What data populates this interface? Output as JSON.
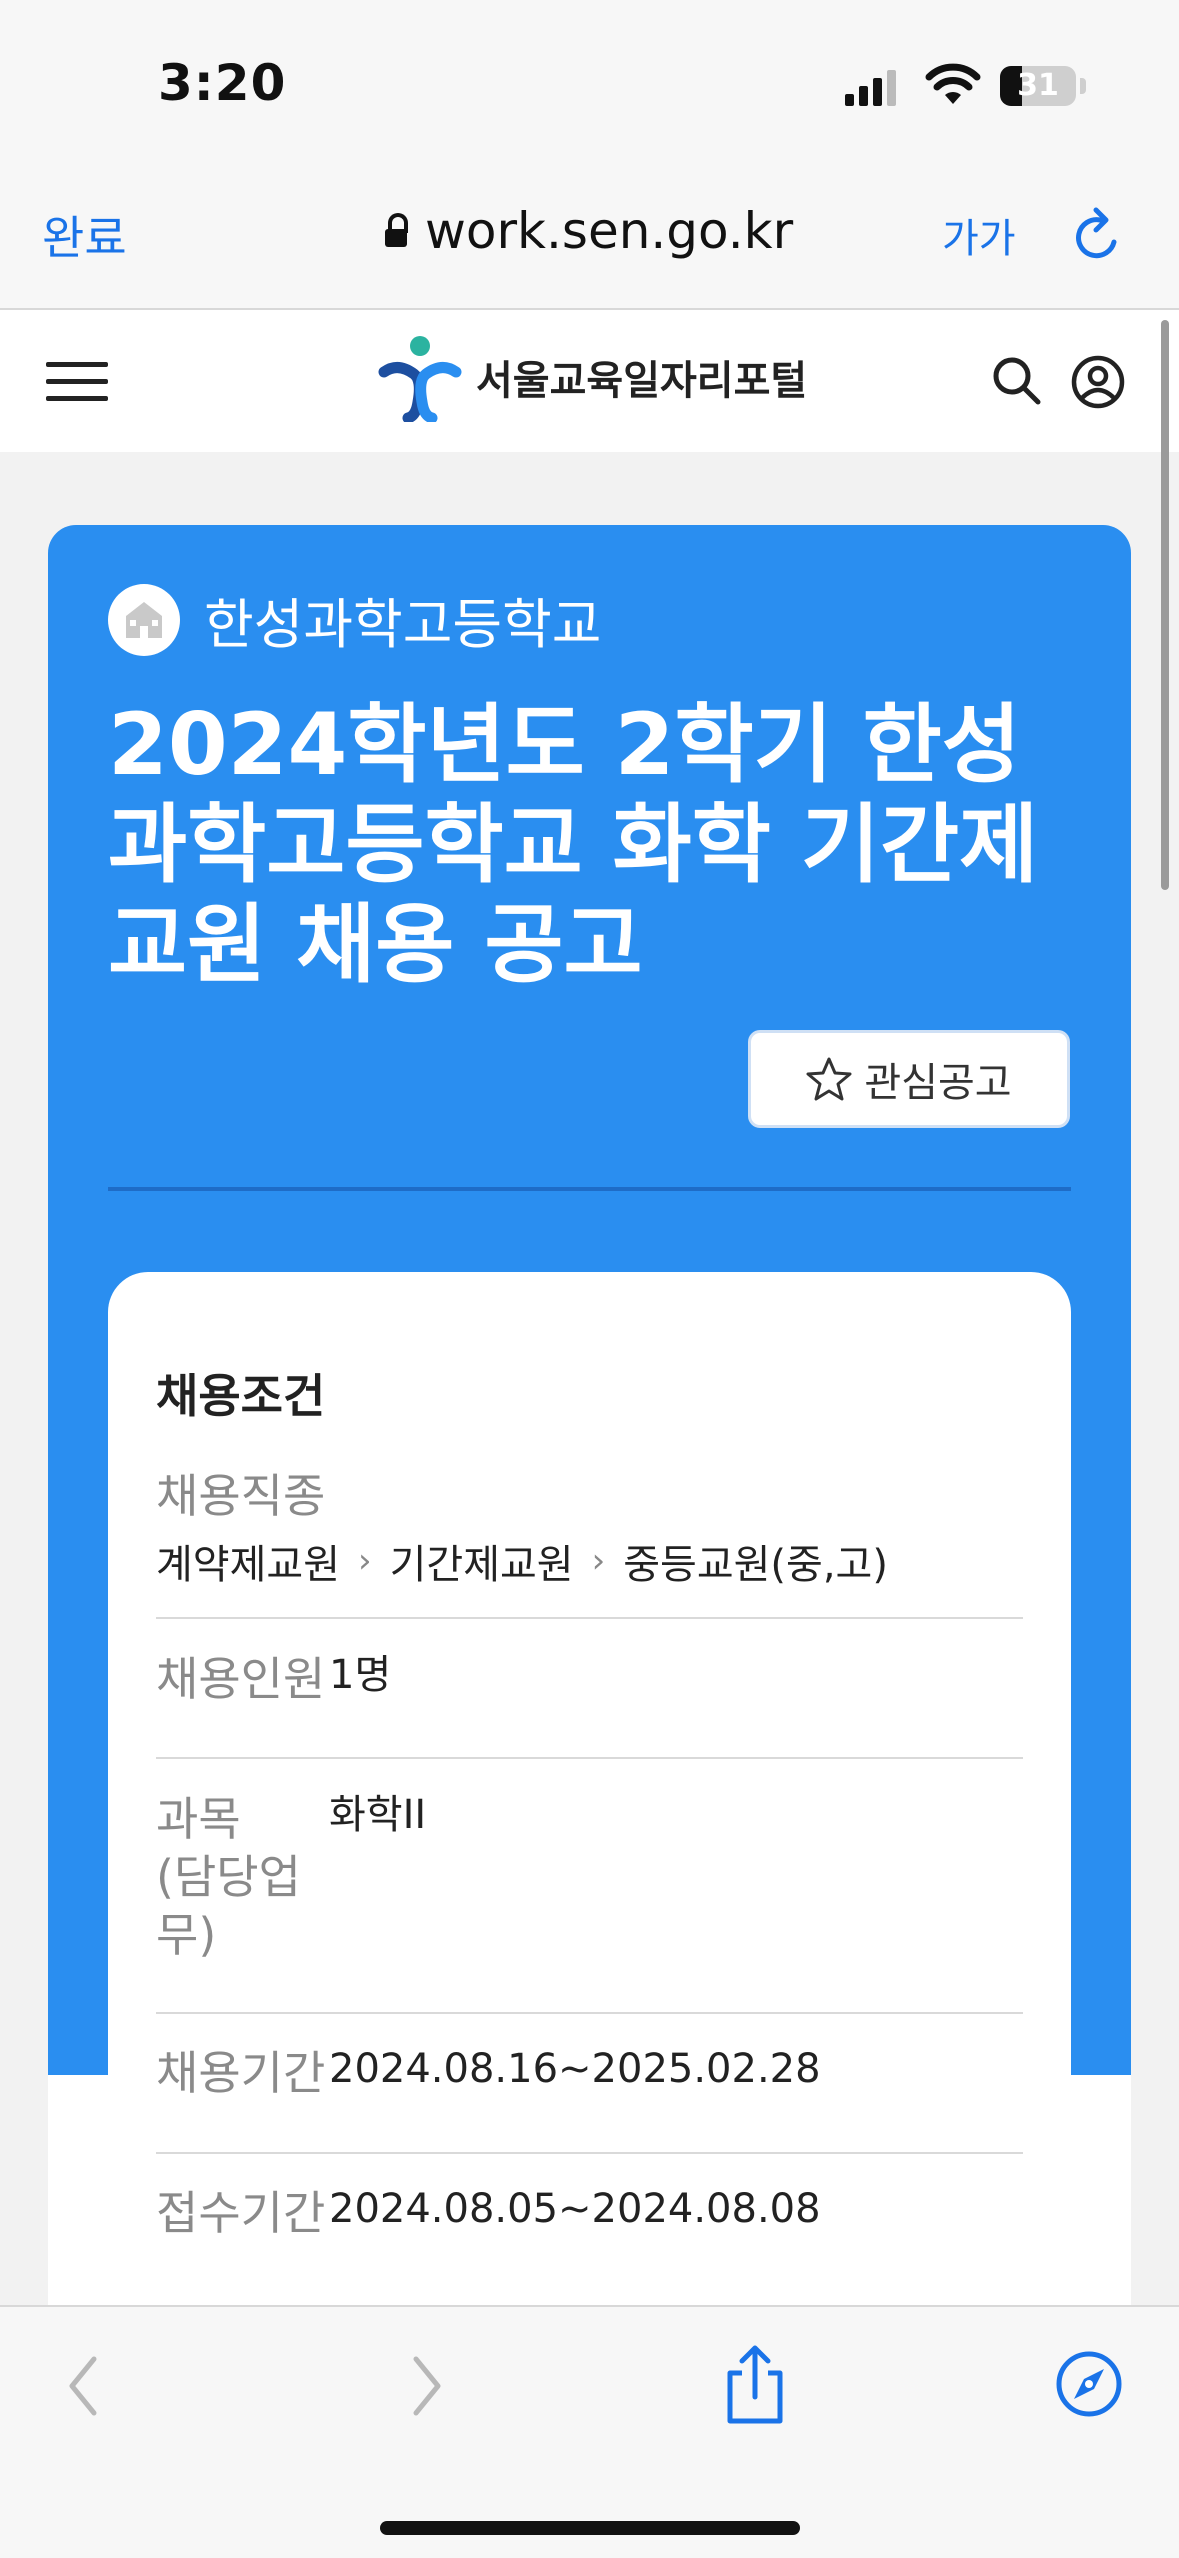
{
  "status_bar": {
    "time": "3:20",
    "battery": "31"
  },
  "browser": {
    "done_label": "완료",
    "url": "work.sen.go.kr",
    "text_size_label": "가가"
  },
  "site": {
    "name": "서울교육일자리포털"
  },
  "job": {
    "school": "한성과학고등학교",
    "title": "2024학년도 2학기 한성과학고등학교 화학 기간제 교원 채용 공고",
    "favorite_label": "관심공고"
  },
  "conditions": {
    "heading": "채용조건",
    "type_label": "채용직종",
    "type_path": [
      "계약제교원",
      "기간제교원",
      "중등교원(중,고)"
    ],
    "rows": [
      {
        "key": "채용인원",
        "value": "1명"
      },
      {
        "key": "과목\n(담당업\n무)",
        "value": "화학II"
      },
      {
        "key": "채용기간",
        "value": "2024.08.16~2025.02.28"
      },
      {
        "key": "접수기간",
        "value": "2024.08.05~2024.08.08"
      }
    ]
  },
  "colors": {
    "accent": "#2a8ef0",
    "link": "#1a73e8"
  },
  "icons": [
    "lock-icon",
    "reload-icon",
    "menu-icon",
    "search-icon",
    "user-icon",
    "school-icon",
    "star-icon",
    "back-icon",
    "forward-icon",
    "share-icon",
    "compass-icon"
  ]
}
